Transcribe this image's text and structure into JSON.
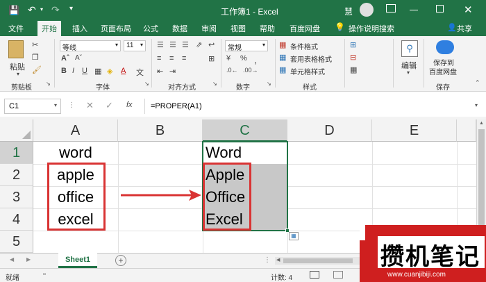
{
  "window": {
    "title": "工作簿1 - Excel",
    "user_initial": "慧"
  },
  "ribbon_tabs": [
    "文件",
    "开始",
    "插入",
    "页面布局",
    "公式",
    "数据",
    "审阅",
    "视图",
    "帮助",
    "百度网盘"
  ],
  "tell_me": "操作说明搜索",
  "share": "共享",
  "clipboard": {
    "paste": "粘贴",
    "label": "剪贴板"
  },
  "font": {
    "name": "等线",
    "size": "11",
    "label": "字体"
  },
  "alignment": {
    "label": "对齐方式"
  },
  "number": {
    "format": "常规",
    "label": "数字"
  },
  "styles": {
    "conditional": "条件格式",
    "table": "套用表格格式",
    "cell": "单元格样式",
    "label": "样式"
  },
  "cells": {
    "A1": "word",
    "A2": "apple",
    "A3": "office",
    "A4": "excel",
    "C1": "Word",
    "C2": "Apple",
    "C3": "Office",
    "C4": "Excel"
  },
  "editing": {
    "label": "编辑"
  },
  "save_group": {
    "button": "保存到\n百度网盘",
    "line1": "保存到",
    "line2": "百度网盘",
    "label": "保存"
  },
  "formula_bar": {
    "name_box": "C1",
    "fx": "fx",
    "formula": "=PROPER(A1)"
  },
  "columns": [
    "A",
    "B",
    "C",
    "D",
    "E"
  ],
  "rows": [
    "1",
    "2",
    "3",
    "4",
    "5"
  ],
  "sheet_tab": "Sheet1",
  "status": {
    "ready": "就绪",
    "count": "计数: 4"
  },
  "watermark": {
    "text": "攒机笔记",
    "url": "www.cuanjibiji.com"
  },
  "colors": {
    "excel_green": "#217346",
    "highlight_red": "#d93333",
    "selection_gray": "#c8c8c8"
  }
}
